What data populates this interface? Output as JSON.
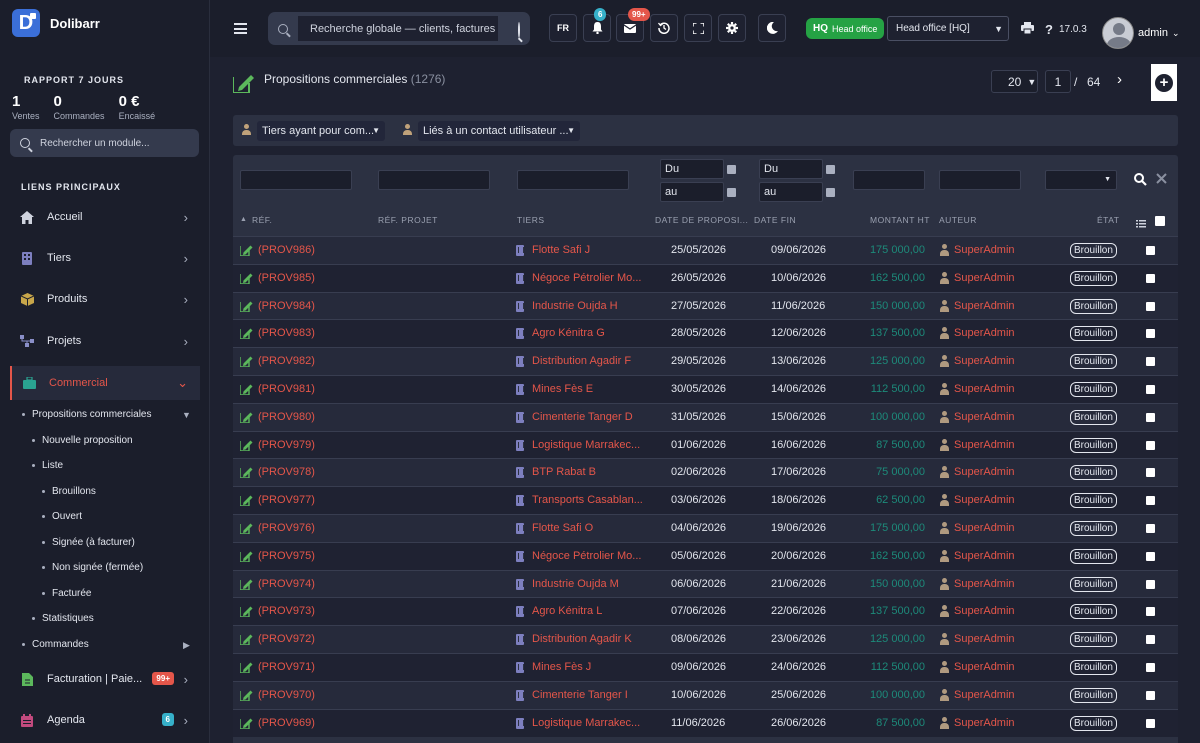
{
  "brand": {
    "name": "Dolibarr",
    "logo_letter": "D"
  },
  "report": {
    "title": "RAPPORT 7 JOURS",
    "stats": [
      {
        "value": "1",
        "label": "Ventes"
      },
      {
        "value": "0",
        "label": "Commandes"
      },
      {
        "value": "0 €",
        "label": "Encaissé"
      }
    ]
  },
  "sidebar": {
    "search_placeholder": "Rechercher un module...",
    "links_title": "LIENS PRINCIPAUX",
    "items": [
      {
        "label": "Accueil",
        "icon": "home-icon"
      },
      {
        "label": "Tiers",
        "icon": "building-icon"
      },
      {
        "label": "Produits",
        "icon": "box-icon"
      },
      {
        "label": "Projets",
        "icon": "project-icon"
      },
      {
        "label": "Commercial",
        "icon": "briefcase-icon"
      },
      {
        "label": "Facturation | Paie...",
        "icon": "invoice-icon",
        "badge": "99+"
      },
      {
        "label": "Agenda",
        "icon": "calendar-icon",
        "badge": "6"
      }
    ],
    "subitems": [
      "Propositions commerciales",
      "Nouvelle proposition",
      "Liste",
      "Brouillons",
      "Ouvert",
      "Signée (à facturer)",
      "Non signée (fermée)",
      "Facturée",
      "Statistiques",
      "Commandes"
    ]
  },
  "topbar": {
    "search_placeholder": "Recherche globale — clients, factures",
    "lang": "FR",
    "notif_badge": "6",
    "mail_badge": "99+",
    "hq_label": "HQ",
    "hq_text": "Head office",
    "entity": "Head office [HQ]",
    "version": "17.0.3",
    "user": "admin"
  },
  "page": {
    "title": "Propositions commerciales",
    "count": "(1276)",
    "per_page": "20",
    "current_page": "1",
    "page_sep": "/",
    "total_pages": "64"
  },
  "filters": {
    "tiers": "Tiers ayant pour com...",
    "contact": "Liés à un contact utilisateur ...",
    "date_from": "Du",
    "date_to": "au"
  },
  "columns": [
    "RÉF.",
    "RÉF. PROJET",
    "TIERS",
    "DATE DE PROPOSI...",
    "DATE FIN",
    "MONTANT HT",
    "AUTEUR",
    "ÉTAT"
  ],
  "rows": [
    {
      "ref": "(PROV986)",
      "tiers": "Flotte Safi J",
      "date": "25/05/2026",
      "date_fin": "09/06/2026",
      "amount": "175 000,00",
      "author": "SuperAdmin",
      "status": "Brouillon"
    },
    {
      "ref": "(PROV985)",
      "tiers": "Négoce Pétrolier Mo...",
      "date": "26/05/2026",
      "date_fin": "10/06/2026",
      "amount": "162 500,00",
      "author": "SuperAdmin",
      "status": "Brouillon"
    },
    {
      "ref": "(PROV984)",
      "tiers": "Industrie Oujda H",
      "date": "27/05/2026",
      "date_fin": "11/06/2026",
      "amount": "150 000,00",
      "author": "SuperAdmin",
      "status": "Brouillon"
    },
    {
      "ref": "(PROV983)",
      "tiers": "Agro Kénitra G",
      "date": "28/05/2026",
      "date_fin": "12/06/2026",
      "amount": "137 500,00",
      "author": "SuperAdmin",
      "status": "Brouillon"
    },
    {
      "ref": "(PROV982)",
      "tiers": "Distribution Agadir F",
      "date": "29/05/2026",
      "date_fin": "13/06/2026",
      "amount": "125 000,00",
      "author": "SuperAdmin",
      "status": "Brouillon"
    },
    {
      "ref": "(PROV981)",
      "tiers": "Mines Fès E",
      "date": "30/05/2026",
      "date_fin": "14/06/2026",
      "amount": "112 500,00",
      "author": "SuperAdmin",
      "status": "Brouillon"
    },
    {
      "ref": "(PROV980)",
      "tiers": "Cimenterie Tanger D",
      "date": "31/05/2026",
      "date_fin": "15/06/2026",
      "amount": "100 000,00",
      "author": "SuperAdmin",
      "status": "Brouillon"
    },
    {
      "ref": "(PROV979)",
      "tiers": "Logistique Marrakec...",
      "date": "01/06/2026",
      "date_fin": "16/06/2026",
      "amount": "87 500,00",
      "author": "SuperAdmin",
      "status": "Brouillon"
    },
    {
      "ref": "(PROV978)",
      "tiers": "BTP Rabat B",
      "date": "02/06/2026",
      "date_fin": "17/06/2026",
      "amount": "75 000,00",
      "author": "SuperAdmin",
      "status": "Brouillon"
    },
    {
      "ref": "(PROV977)",
      "tiers": "Transports Casablan...",
      "date": "03/06/2026",
      "date_fin": "18/06/2026",
      "amount": "62 500,00",
      "author": "SuperAdmin",
      "status": "Brouillon"
    },
    {
      "ref": "(PROV976)",
      "tiers": "Flotte Safi O",
      "date": "04/06/2026",
      "date_fin": "19/06/2026",
      "amount": "175 000,00",
      "author": "SuperAdmin",
      "status": "Brouillon"
    },
    {
      "ref": "(PROV975)",
      "tiers": "Négoce Pétrolier Mo...",
      "date": "05/06/2026",
      "date_fin": "20/06/2026",
      "amount": "162 500,00",
      "author": "SuperAdmin",
      "status": "Brouillon"
    },
    {
      "ref": "(PROV974)",
      "tiers": "Industrie Oujda M",
      "date": "06/06/2026",
      "date_fin": "21/06/2026",
      "amount": "150 000,00",
      "author": "SuperAdmin",
      "status": "Brouillon"
    },
    {
      "ref": "(PROV973)",
      "tiers": "Agro Kénitra L",
      "date": "07/06/2026",
      "date_fin": "22/06/2026",
      "amount": "137 500,00",
      "author": "SuperAdmin",
      "status": "Brouillon"
    },
    {
      "ref": "(PROV972)",
      "tiers": "Distribution Agadir K",
      "date": "08/06/2026",
      "date_fin": "23/06/2026",
      "amount": "125 000,00",
      "author": "SuperAdmin",
      "status": "Brouillon"
    },
    {
      "ref": "(PROV971)",
      "tiers": "Mines Fès J",
      "date": "09/06/2026",
      "date_fin": "24/06/2026",
      "amount": "112 500,00",
      "author": "SuperAdmin",
      "status": "Brouillon"
    },
    {
      "ref": "(PROV970)",
      "tiers": "Cimenterie Tanger I",
      "date": "10/06/2026",
      "date_fin": "25/06/2026",
      "amount": "100 000,00",
      "author": "SuperAdmin",
      "status": "Brouillon"
    },
    {
      "ref": "(PROV969)",
      "tiers": "Logistique Marrakec...",
      "date": "11/06/2026",
      "date_fin": "26/06/2026",
      "amount": "87 500,00",
      "author": "SuperAdmin",
      "status": "Brouillon"
    }
  ]
}
